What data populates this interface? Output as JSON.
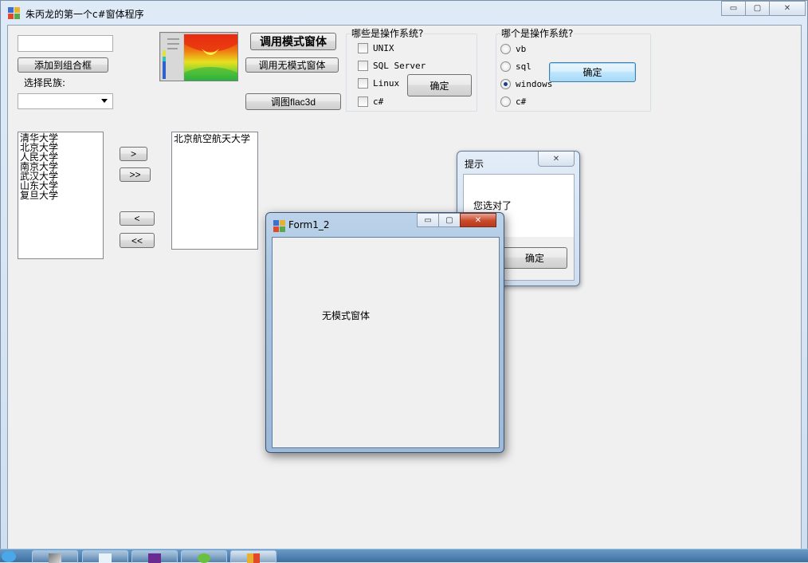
{
  "main_window": {
    "title": "朱丙龙的第一个c#窗体程序",
    "caption_buttons": {
      "minimize": "▭",
      "maximize": "▢",
      "close": "✕"
    }
  },
  "left_panel": {
    "textbox_value": "",
    "add_button": "添加到组合框",
    "nation_label": "选择民族:",
    "nation_combo_value": ""
  },
  "image_area": {
    "image_name": "heatmap"
  },
  "buttons": {
    "modal": "调用模式窗体",
    "modeless": "调用无模式窗体",
    "flac3d": "调图flac3d"
  },
  "checkbox_group": {
    "title": "哪些是操作系统?",
    "items": [
      {
        "label": "UNIX",
        "checked": false
      },
      {
        "label": "SQL Server",
        "checked": false
      },
      {
        "label": "Linux",
        "checked": false
      },
      {
        "label": "c#",
        "checked": false
      }
    ],
    "ok_button": "确定"
  },
  "radio_group": {
    "title": "哪个是操作系统?",
    "items": [
      {
        "label": "vb",
        "selected": false
      },
      {
        "label": "sql",
        "selected": false
      },
      {
        "label": "windows",
        "selected": true
      },
      {
        "label": "c#",
        "selected": false
      }
    ],
    "ok_button": "确定"
  },
  "list_left": {
    "items": [
      "清华大学",
      "北京大学",
      "人民大学",
      "南京大学",
      "武汉大学",
      "山东大学",
      "复旦大学"
    ]
  },
  "list_right": {
    "items": [
      "北京航空航天大学"
    ]
  },
  "transfer_buttons": {
    "move_one_right": ">",
    "move_all_right": ">>",
    "move_one_left": "<",
    "move_all_left": "<<"
  },
  "msg_dialog": {
    "title": "提示",
    "message": "您选对了",
    "ok_button": "确定",
    "close_glyph": "✕"
  },
  "form12": {
    "title": "Form1_2",
    "label": "无模式窗体",
    "caption_buttons": {
      "minimize": "▭",
      "maximize": "▢",
      "close": "✕"
    }
  },
  "colors": {
    "client_bg": "#f0f0f0",
    "titlebar_bg": "#dfeaf7",
    "close_red": "#c94a2c",
    "taskbar": "#3c6ea0"
  }
}
